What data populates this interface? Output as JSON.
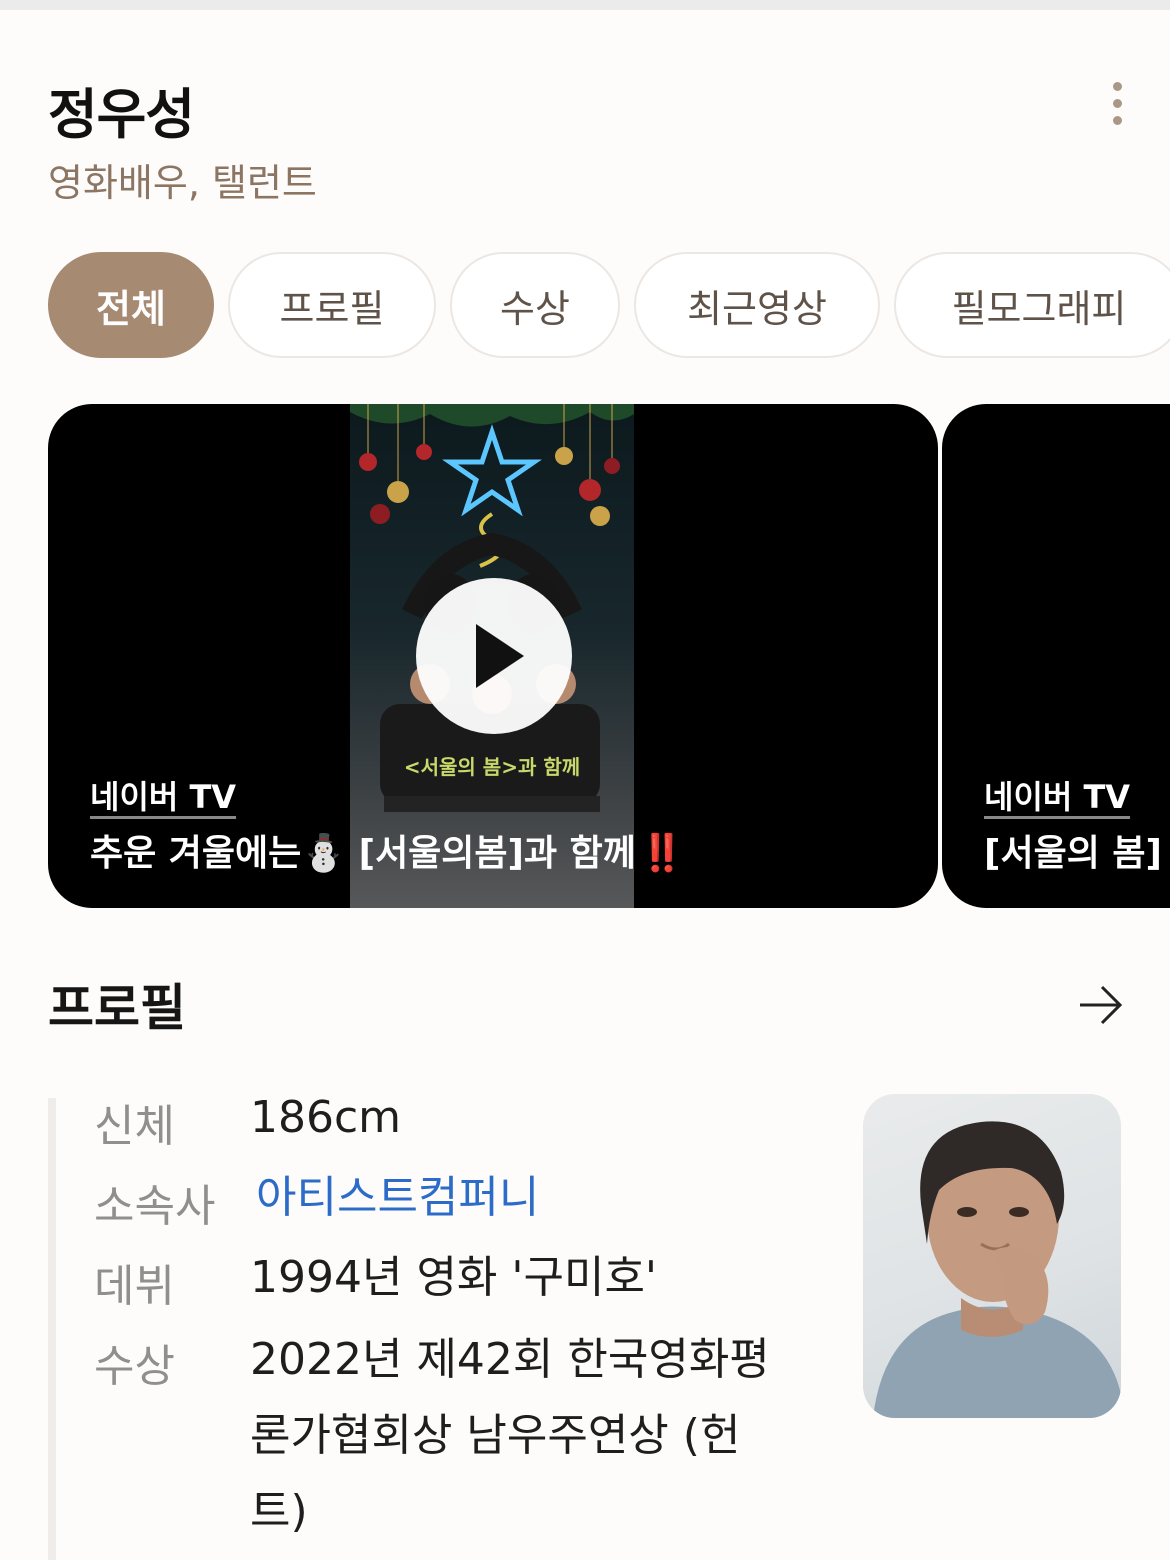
{
  "header": {
    "name": "정우성",
    "subtitle": "영화배우, 탤런트"
  },
  "tabs": [
    {
      "label": "전체",
      "active": true
    },
    {
      "label": "프로필",
      "active": false
    },
    {
      "label": "수상",
      "active": false
    },
    {
      "label": "최근영상",
      "active": false
    },
    {
      "label": "필모그래피",
      "active": false
    }
  ],
  "videos": [
    {
      "source": "네이버 TV",
      "title": "추운 겨울에는⛄ [서울의봄]과 함께",
      "title_emoji": "‼️",
      "thumbnail_caption": "<서울의 봄>과 함께"
    },
    {
      "source": "네이버 TV",
      "title": "[서울의 봄]"
    }
  ],
  "profile": {
    "title": "프로필",
    "rows": [
      {
        "label": "신체",
        "value": "186cm"
      },
      {
        "label": "소속사",
        "value": "아티스트컴퍼니"
      },
      {
        "label": "데뷔",
        "value": "1994년 영화 '구미호'"
      },
      {
        "label": "수상",
        "value_lines": [
          "2022년 제42회 한국영화평",
          "론가협회상 남우주연상 (헌",
          "트)"
        ]
      }
    ]
  },
  "colors": {
    "accent": "#a68a71",
    "subtitle": "#8c7663",
    "link": "#2c6cc8"
  }
}
